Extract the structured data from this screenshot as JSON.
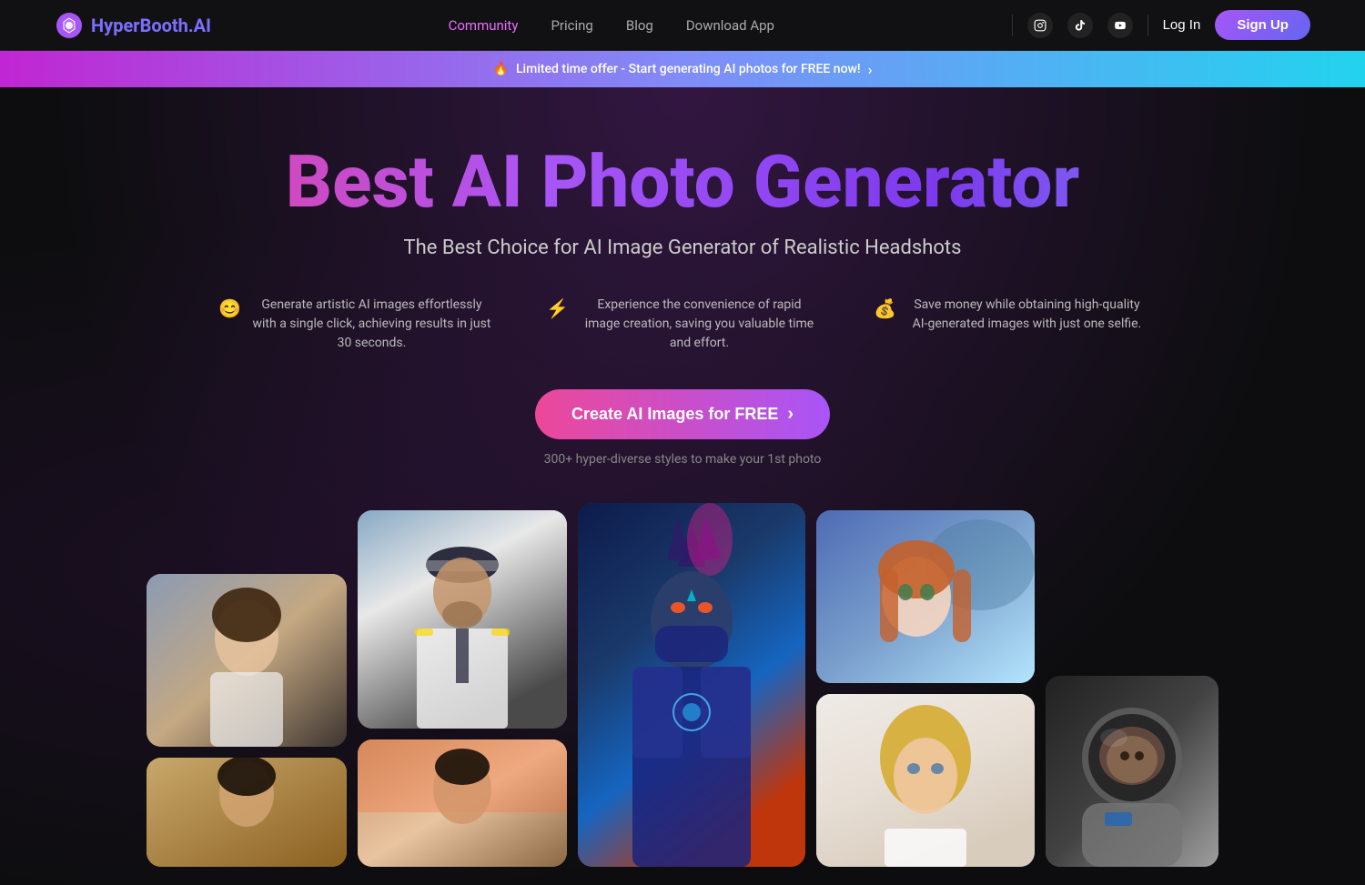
{
  "brand": {
    "name": "HyperBooth",
    "suffix": ".AI",
    "logo_symbol": "⬡"
  },
  "navbar": {
    "links": [
      {
        "id": "community",
        "label": "Community",
        "active": true
      },
      {
        "id": "pricing",
        "label": "Pricing",
        "active": false
      },
      {
        "id": "blog",
        "label": "Blog",
        "active": false
      },
      {
        "id": "download",
        "label": "Download App",
        "active": false
      }
    ],
    "social": [
      {
        "id": "instagram",
        "icon": "📷",
        "label": "Instagram"
      },
      {
        "id": "tiktok",
        "icon": "♪",
        "label": "TikTok"
      },
      {
        "id": "youtube",
        "icon": "▶",
        "label": "YouTube"
      }
    ],
    "login_label": "Log In",
    "signup_label": "Sign Up"
  },
  "banner": {
    "emoji": "🔥",
    "text": "Limited time offer - Start generating AI photos for FREE now!",
    "arrow": "›"
  },
  "hero": {
    "title": "Best AI Photo Generator",
    "subtitle": "The Best Choice for AI Image Generator of Realistic Headshots"
  },
  "features": [
    {
      "icon": "😊",
      "text": "Generate artistic AI images effortlessly with a single click, achieving results in just 30 seconds."
    },
    {
      "icon": "⚡",
      "text": "Experience the convenience of rapid image creation, saving you valuable time and effort."
    },
    {
      "icon": "💰",
      "text": "Save money while obtaining high-quality AI-generated images with just one selfie."
    }
  ],
  "cta": {
    "button_label": "Create AI Images for FREE",
    "arrow": "›",
    "subtext": "300+ hyper-diverse styles to make your 1st photo"
  },
  "gallery": {
    "images": [
      {
        "id": "woman-white",
        "alt": "Woman in white top",
        "col": 0
      },
      {
        "id": "woman-bottom",
        "alt": "Woman portrait bottom",
        "col": 0
      },
      {
        "id": "pilot",
        "alt": "Man in pilot uniform",
        "col": 1
      },
      {
        "id": "desert-man",
        "alt": "Man in desert",
        "col": 1
      },
      {
        "id": "ninja",
        "alt": "Anime ninja character",
        "col": 2
      },
      {
        "id": "anime-girl",
        "alt": "Anime girl painting",
        "col": 3
      },
      {
        "id": "blonde",
        "alt": "Blonde woman",
        "col": 3
      },
      {
        "id": "astronaut",
        "alt": "Astronaut portrait",
        "col": 4
      }
    ]
  },
  "colors": {
    "brand_purple": "#7c3aed",
    "brand_pink": "#ec4899",
    "brand_cyan": "#22d3ee",
    "nav_bg": "#111114",
    "page_bg": "#0d0d0f"
  }
}
